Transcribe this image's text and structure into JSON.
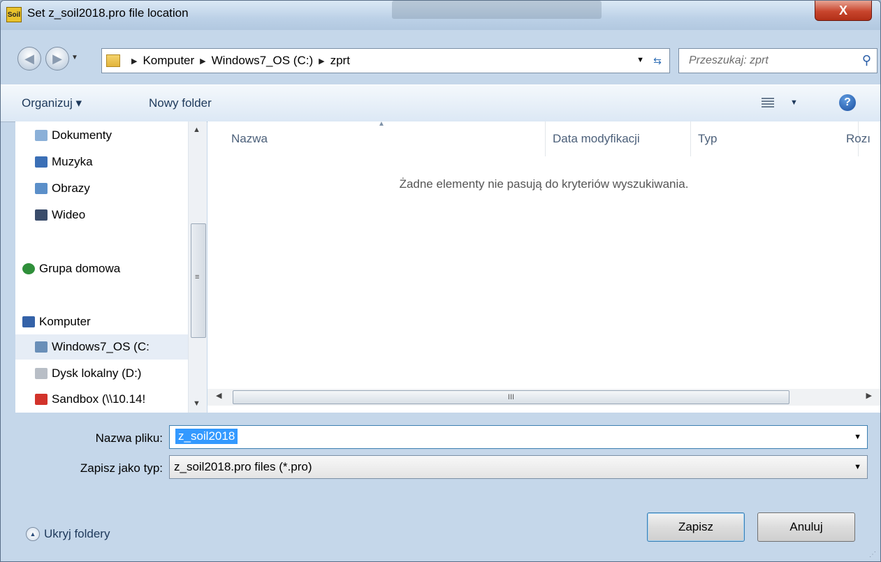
{
  "window": {
    "title": "Set z_soil2018.pro file location",
    "app_icon_text": "Soil",
    "close_label": "X"
  },
  "address": {
    "crumbs": [
      "Komputer",
      "Windows7_OS (C:)",
      "zprt"
    ],
    "search_placeholder": "Przeszukaj: zprt"
  },
  "toolbar": {
    "organize_label": "Organizuj ▾",
    "new_folder_label": "Nowy folder"
  },
  "sidebar": {
    "items": [
      {
        "label": "Dokumenty",
        "icon": "documents-icon",
        "color": "#8bb0d8"
      },
      {
        "label": "Muzyka",
        "icon": "music-icon",
        "color": "#3b6fb6"
      },
      {
        "label": "Obrazy",
        "icon": "pictures-icon",
        "color": "#5b8fc9"
      },
      {
        "label": "Wideo",
        "icon": "video-icon",
        "color": "#3a4c6a"
      },
      {
        "label": "Grupa domowa",
        "icon": "homegroup-icon",
        "color": "#2f8f3a"
      },
      {
        "label": "Komputer",
        "icon": "computer-icon",
        "color": "#3462a8"
      },
      {
        "label": "Windows7_OS (C:",
        "icon": "drive-icon",
        "color": "#6a8fb8",
        "selected": true
      },
      {
        "label": "Dysk lokalny (D:)",
        "icon": "drive-icon",
        "color": "#b8bec6"
      },
      {
        "label": "Sandbox (\\\\10.14!",
        "icon": "network-drive-icon",
        "color": "#d2332b"
      }
    ]
  },
  "files": {
    "columns": [
      "Nazwa",
      "Data modyfikacji",
      "Typ",
      "Rozı"
    ],
    "empty_message": "Żadne elementy nie pasują do kryteriów wyszukiwania."
  },
  "form": {
    "filename_label": "Nazwa pliku:",
    "filename_value": "z_soil2018",
    "filetype_label": "Zapisz jako typ:",
    "filetype_value": "z_soil2018.pro files (*.pro)"
  },
  "footer": {
    "hide_folders_label": "Ukryj foldery",
    "save_label": "Zapisz",
    "cancel_label": "Anuluj"
  }
}
